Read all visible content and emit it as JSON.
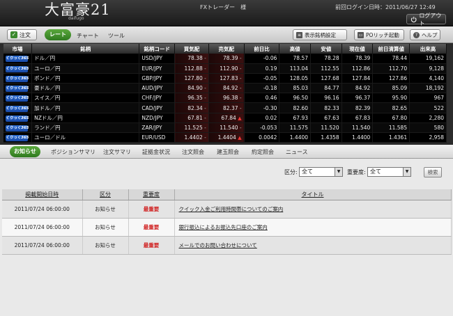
{
  "header": {
    "logo_main": "大富豪21",
    "logo_sub": "daifugo",
    "user_label": "FXトレーダー　様",
    "login_time": "前回ログイン日時：2011/06/27 12:49",
    "logout_label": "ログアウト"
  },
  "toolbar": {
    "order_label": "注文",
    "nav_rate": "レート",
    "nav_chart": "チャート",
    "nav_tool": "ツール",
    "symbol_settings_label": "表示銘柄設定",
    "rich_launch_label": "POリッチ起動",
    "help_label": "ヘルプ"
  },
  "rate_table": {
    "headers": [
      "市場",
      "銘柄",
      "銘柄コード",
      "買気配",
      "売気配",
      "前日比",
      "高値",
      "安値",
      "現在値",
      "前日清算値",
      "出来高"
    ],
    "market_badge": "くりっく365",
    "rows": [
      {
        "name": "ドル／円",
        "code": "USD/JPY",
        "bid": "78.38",
        "bid_mark": "-",
        "ask": "78.39",
        "ask_mark": "-",
        "change": "-0.06",
        "high": "78.57",
        "low": "78.28",
        "last": "78.39",
        "prev": "78.44",
        "volume": "19,162"
      },
      {
        "name": "ユーロ／円",
        "code": "EUR/JPY",
        "bid": "112.88",
        "bid_mark": "-",
        "ask": "112.90",
        "ask_mark": "-",
        "change": "0.19",
        "high": "113.04",
        "low": "112.55",
        "last": "112.86",
        "prev": "112.70",
        "volume": "9,128"
      },
      {
        "name": "ポンド／円",
        "code": "GBP/JPY",
        "bid": "127.80",
        "bid_mark": "-",
        "ask": "127.83",
        "ask_mark": "-",
        "change": "-0.05",
        "high": "128.05",
        "low": "127.68",
        "last": "127.84",
        "prev": "127.86",
        "volume": "4,140"
      },
      {
        "name": "豪ドル／円",
        "code": "AUD/JPY",
        "bid": "84.90",
        "bid_mark": "-",
        "ask": "84.92",
        "ask_mark": "-",
        "change": "-0.18",
        "high": "85.03",
        "low": "84.77",
        "last": "84.92",
        "prev": "85.09",
        "volume": "18,192"
      },
      {
        "name": "スイス／円",
        "code": "CHF/JPY",
        "bid": "96.35",
        "bid_mark": "-",
        "ask": "96.38",
        "ask_mark": "-",
        "change": "0.46",
        "high": "96.50",
        "low": "96.16",
        "last": "96.37",
        "prev": "95.90",
        "volume": "967"
      },
      {
        "name": "加ドル／円",
        "code": "CAD/JPY",
        "bid": "82.34",
        "bid_mark": "-",
        "ask": "82.37",
        "ask_mark": "-",
        "change": "-0.30",
        "high": "82.60",
        "low": "82.33",
        "last": "82.39",
        "prev": "82.65",
        "volume": "522"
      },
      {
        "name": "NZドル／円",
        "code": "NZD/JPY",
        "bid": "67.81",
        "bid_mark": "-",
        "ask": "67.84",
        "ask_mark": "▲",
        "change": "0.02",
        "high": "67.93",
        "low": "67.63",
        "last": "67.83",
        "prev": "67.80",
        "volume": "2,280"
      },
      {
        "name": "ランド／円",
        "code": "ZAR/JPY",
        "bid": "11.525",
        "bid_mark": "-",
        "ask": "11.540",
        "ask_mark": "-",
        "change": "-0.053",
        "high": "11.575",
        "low": "11.520",
        "last": "11.540",
        "prev": "11.585",
        "volume": "580"
      },
      {
        "name": "ユーロ／ドル",
        "code": "EUR/USD",
        "bid": "1.4402",
        "bid_mark": "-",
        "ask": "1.4404",
        "ask_mark": "▲",
        "change": "0.0042",
        "high": "1.4400",
        "low": "1.4358",
        "last": "1.4400",
        "prev": "1.4361",
        "volume": "2,958"
      }
    ]
  },
  "subtabs": [
    "お知らせ",
    "ポジションサマリ",
    "注文サマリ",
    "証拠金状況",
    "注文照会",
    "建玉照会",
    "約定照会",
    "ニュース"
  ],
  "filter": {
    "category_label": "区分:",
    "category_value": "全て",
    "priority_label": "重要度:",
    "priority_value": "全て",
    "search_label": "検索"
  },
  "news_table": {
    "headers": [
      "掲載開始日時",
      "区分",
      "重要度",
      "タイトル"
    ],
    "rows": [
      {
        "date": "2011/07/24 06:00:00",
        "category": "お知らせ",
        "priority": "最重要",
        "title": "クイック入金ご利用時間帯についてのご案内"
      },
      {
        "date": "2011/07/24 06:00:00",
        "category": "お知らせ",
        "priority": "最重要",
        "title": "銀行振込によるお振込先口座のご案内"
      },
      {
        "date": "2011/07/24 06:00:00",
        "category": "お知らせ",
        "priority": "最重要",
        "title": "メールでのお問い合わせについて"
      }
    ]
  }
}
